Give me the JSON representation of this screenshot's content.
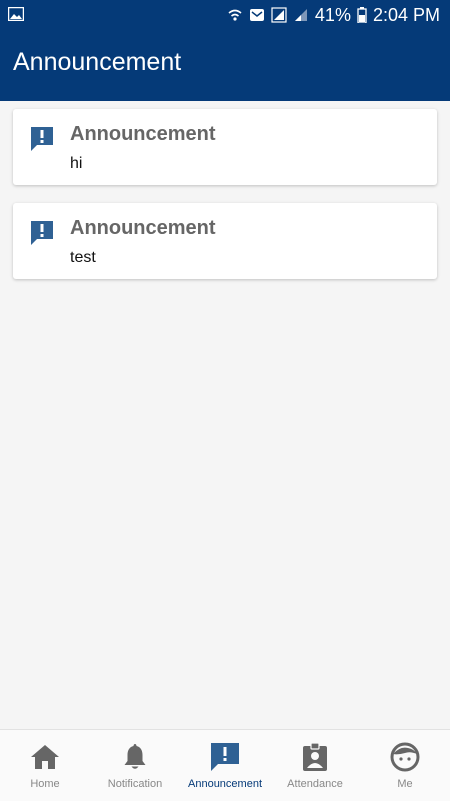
{
  "statusbar": {
    "battery_percent": "41%",
    "time": "2:04 PM",
    "icons": [
      "image-icon",
      "wifi-icon",
      "message-icon",
      "signal-icon",
      "signal-icon",
      "battery-icon"
    ]
  },
  "appbar": {
    "title": "Announcement"
  },
  "announcements": [
    {
      "title": "Announcement",
      "body": "hi"
    },
    {
      "title": "Announcement",
      "body": "test"
    }
  ],
  "bottom_nav": [
    {
      "label": "Home",
      "icon": "home-icon"
    },
    {
      "label": "Notification",
      "icon": "bell-icon"
    },
    {
      "label": "Announcement",
      "icon": "announcement-icon",
      "active": true
    },
    {
      "label": "Attendance",
      "icon": "badge-icon"
    },
    {
      "label": "Me",
      "icon": "face-icon"
    }
  ],
  "colors": {
    "primary": "#053a78",
    "icon_blue": "#2f6194",
    "inactive": "#888888"
  }
}
